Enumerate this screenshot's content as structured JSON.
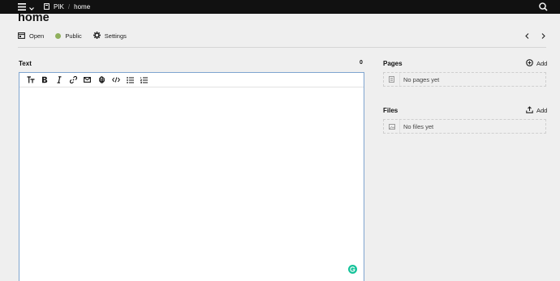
{
  "topbar": {
    "site_name": "PIK",
    "separator": "/",
    "current_page": "home"
  },
  "page": {
    "title": "home"
  },
  "header": {
    "open_label": "Open",
    "status_label": "Public",
    "status_color": "#8fb05d",
    "settings_label": "Settings"
  },
  "text_field": {
    "label": "Text",
    "counter": "0",
    "value": "",
    "toolbar": [
      "headings",
      "bold",
      "italic",
      "link",
      "email",
      "file",
      "code",
      "bullet-list",
      "ordered-list"
    ]
  },
  "pages_section": {
    "label": "Pages",
    "add_label": "Add",
    "empty_text": "No pages yet"
  },
  "files_section": {
    "label": "Files",
    "add_label": "Add",
    "empty_text": "No files yet"
  },
  "colors": {
    "topbar": "#111111",
    "background": "#efefef",
    "editor_focus": "#7fa4cf",
    "grammarly": "#15c39a"
  }
}
